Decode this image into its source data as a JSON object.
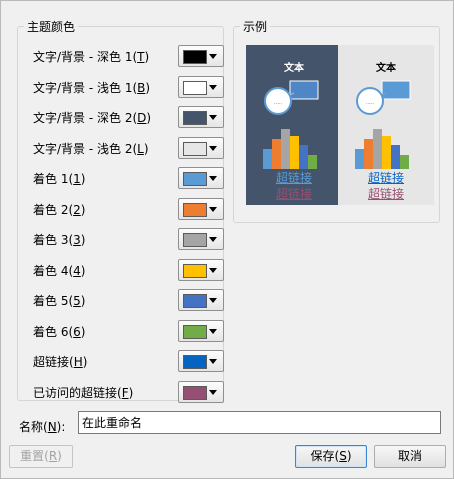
{
  "theme_group": {
    "title": "主题颜色",
    "rows": [
      {
        "label": "文字/背景 - 深色 1(",
        "key": "T",
        "end": ")",
        "color": "#000000"
      },
      {
        "label": "文字/背景 - 浅色 1(",
        "key": "B",
        "end": ")",
        "color": "#ffffff"
      },
      {
        "label": "文字/背景 - 深色 2(",
        "key": "D",
        "end": ")",
        "color": "#44546a"
      },
      {
        "label": "文字/背景 - 浅色 2(",
        "key": "L",
        "end": ")",
        "color": "#e7e6e6"
      },
      {
        "label": "着色 1(",
        "key": "1",
        "end": ")",
        "color": "#5b9bd5"
      },
      {
        "label": "着色 2(",
        "key": "2",
        "end": ")",
        "color": "#ed7d31"
      },
      {
        "label": "着色 3(",
        "key": "3",
        "end": ")",
        "color": "#a5a5a5"
      },
      {
        "label": "着色 4(",
        "key": "4",
        "end": ")",
        "color": "#ffc000"
      },
      {
        "label": "着色 5(",
        "key": "5",
        "end": ")",
        "color": "#4472c4"
      },
      {
        "label": "着色 6(",
        "key": "6",
        "end": ")",
        "color": "#70ad47"
      },
      {
        "label": "超链接(",
        "key": "H",
        "end": ")",
        "color": "#0563c1"
      },
      {
        "label": "已访问的超链接(",
        "key": "F",
        "end": ")",
        "color": "#954f72"
      }
    ]
  },
  "sample_group": {
    "title": "示例",
    "text_label": "文本",
    "hyperlink": "超链接",
    "visited_hyperlink": "超链接",
    "link_color_dark": "#5b9bd5",
    "visited_color_dark": "#954f72"
  },
  "name_row": {
    "label_prefix": "名称(",
    "label_key": "N",
    "label_suffix": "):",
    "value": "在此重命名"
  },
  "buttons": {
    "reset_prefix": "重置(",
    "reset_key": "R",
    "reset_suffix": ")",
    "save_prefix": "保存(",
    "save_key": "S",
    "save_suffix": ")",
    "cancel": "取消"
  }
}
